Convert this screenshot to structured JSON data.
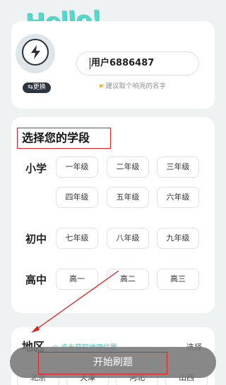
{
  "greeting": "Hello!",
  "profile": {
    "swap_label": "⇆更换",
    "username": "用户6886487",
    "hint": "建议取个响亮的名字",
    "hint_icon": "pointing-hand-icon"
  },
  "grade_section": {
    "title": "选择您的学段",
    "levels": [
      {
        "label": "小学",
        "grades": [
          "一年级",
          "二年级",
          "三年级",
          "四年级",
          "五年级",
          "六年级"
        ]
      },
      {
        "label": "初中",
        "grades": [
          "七年级",
          "八年级",
          "九年级"
        ]
      },
      {
        "label": "高中",
        "grades": [
          "高一",
          "高二",
          "高三"
        ]
      }
    ]
  },
  "region_section": {
    "title": "地区",
    "subtitle": "◎ 点击获取地理位置",
    "select_label": "选择",
    "items": [
      "北京",
      "天津",
      "河北",
      "山西"
    ]
  },
  "start_button": {
    "label": "开始刷题"
  },
  "colors": {
    "accent": "#54d8c9",
    "annotation_red": "#e02020",
    "dark_button": "#2b3440"
  }
}
